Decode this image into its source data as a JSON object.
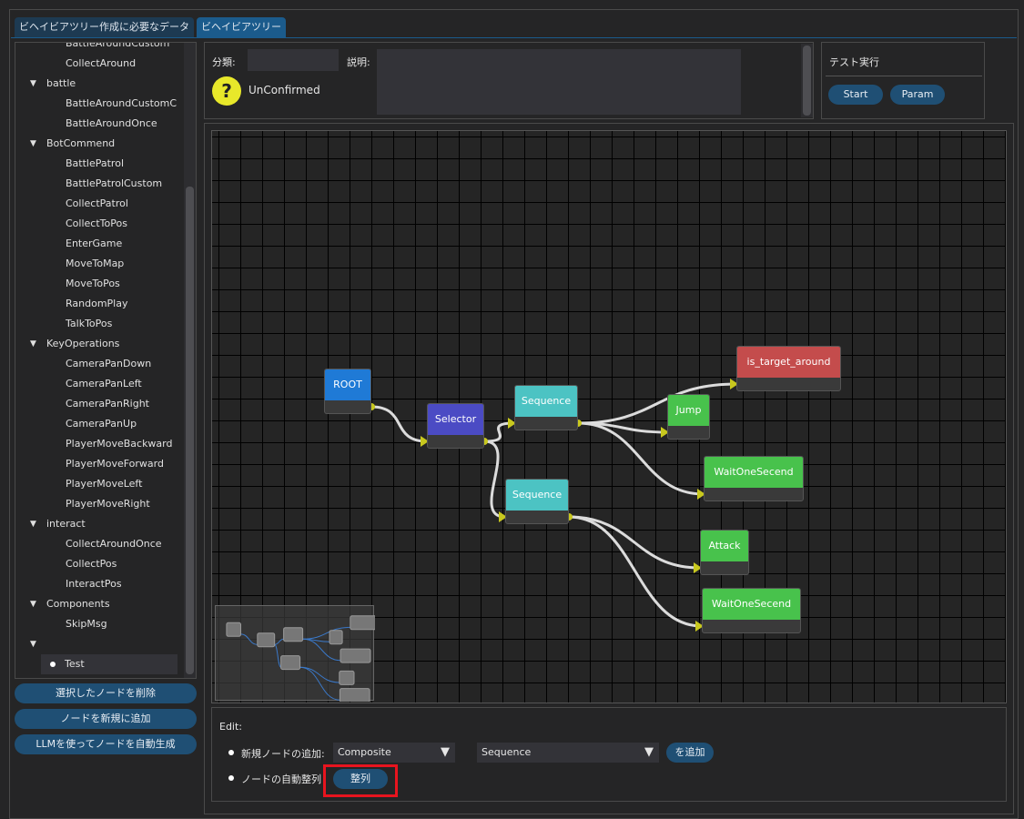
{
  "tabs": [
    {
      "label": "ビヘイビアツリー作成に必要なデータ",
      "active": false
    },
    {
      "label": "ビヘイビアツリー",
      "active": true
    }
  ],
  "tree": {
    "items": [
      {
        "label": "BattleAroundCustom",
        "level": 2
      },
      {
        "label": "CollectAround",
        "level": 2
      },
      {
        "label": "battle",
        "level": 1
      },
      {
        "label": "BattleAroundCustomC",
        "level": 2
      },
      {
        "label": "BattleAroundOnce",
        "level": 2
      },
      {
        "label": "BotCommend",
        "level": 1
      },
      {
        "label": "BattlePatrol",
        "level": 2
      },
      {
        "label": "BattlePatrolCustom",
        "level": 2
      },
      {
        "label": "CollectPatrol",
        "level": 2
      },
      {
        "label": "CollectToPos",
        "level": 2
      },
      {
        "label": "EnterGame",
        "level": 2
      },
      {
        "label": "MoveToMap",
        "level": 2
      },
      {
        "label": "MoveToPos",
        "level": 2
      },
      {
        "label": "RandomPlay",
        "level": 2
      },
      {
        "label": "TalkToPos",
        "level": 2
      },
      {
        "label": "KeyOperations",
        "level": 1
      },
      {
        "label": "CameraPanDown",
        "level": 2
      },
      {
        "label": "CameraPanLeft",
        "level": 2
      },
      {
        "label": "CameraPanRight",
        "level": 2
      },
      {
        "label": "CameraPanUp",
        "level": 2
      },
      {
        "label": "PlayerMoveBackward",
        "level": 2
      },
      {
        "label": "PlayerMoveForward",
        "level": 2
      },
      {
        "label": "PlayerMoveLeft",
        "level": 2
      },
      {
        "label": "PlayerMoveRight",
        "level": 2
      },
      {
        "label": "interact",
        "level": 1
      },
      {
        "label": "CollectAroundOnce",
        "level": 2
      },
      {
        "label": "CollectPos",
        "level": 2
      },
      {
        "label": "InteractPos",
        "level": 2
      },
      {
        "label": "Components",
        "level": 1
      },
      {
        "label": "SkipMsg",
        "level": 2
      },
      {
        "label": "",
        "level": 1
      },
      {
        "label": "Test",
        "level": 3,
        "selected": true
      }
    ]
  },
  "left_buttons": {
    "delete": "選択したノードを削除",
    "add_new": "ノードを新規に追加",
    "llm": "LLMを使ってノードを自動生成"
  },
  "info": {
    "category_label": "分類:",
    "category_value": "",
    "description_label": "説明:",
    "description_value": "",
    "status": "UnConfirmed",
    "status_icon": "question-icon",
    "status_color": "#e8e82a"
  },
  "test": {
    "title": "テスト実行",
    "start": "Start",
    "param": "Param"
  },
  "graph": {
    "nodes": [
      {
        "id": "root",
        "label": "ROOT",
        "color": "#1f7ad6"
      },
      {
        "id": "selector",
        "label": "Selector",
        "color": "#4b4bc4"
      },
      {
        "id": "seq1",
        "label": "Sequence",
        "color": "#4cc3c3"
      },
      {
        "id": "seq2",
        "label": "Sequence",
        "color": "#4cc3c3"
      },
      {
        "id": "target",
        "label": "is_target_around",
        "color": "#c44c4c"
      },
      {
        "id": "jump",
        "label": "Jump",
        "color": "#48c24c"
      },
      {
        "id": "wait1",
        "label": "WaitOneSecend",
        "color": "#48c24c"
      },
      {
        "id": "attack",
        "label": "Attack",
        "color": "#48c24c"
      },
      {
        "id": "wait2",
        "label": "WaitOneSecend",
        "color": "#48c24c"
      }
    ],
    "links": [
      [
        "root",
        "selector"
      ],
      [
        "selector",
        "seq1"
      ],
      [
        "selector",
        "seq2"
      ],
      [
        "seq1",
        "target"
      ],
      [
        "seq1",
        "jump"
      ],
      [
        "seq1",
        "wait1"
      ],
      [
        "seq2",
        "attack"
      ],
      [
        "seq2",
        "wait2"
      ]
    ],
    "link_color": "#dcdcdc",
    "pin_color": "#c8c81e"
  },
  "edit": {
    "title": "Edit:",
    "add_label": "新規ノードの追加:",
    "type_value": "Composite",
    "node_value": "Sequence",
    "add_button": "を追加",
    "arrange_label": "ノードの自動整列",
    "arrange_button": "整列",
    "highlight_color": "#e8141e"
  }
}
